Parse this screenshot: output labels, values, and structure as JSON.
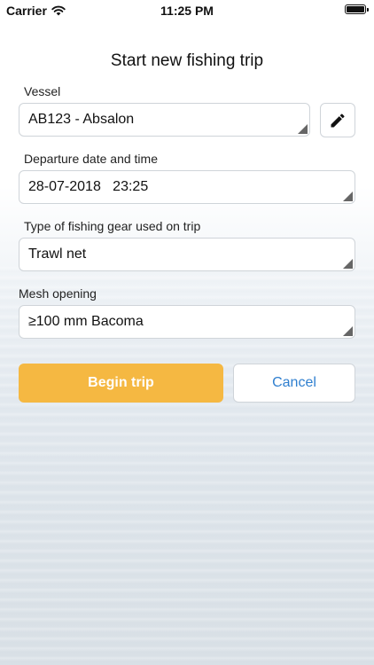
{
  "status_bar": {
    "carrier": "Carrier",
    "time": "11:25 PM"
  },
  "screen": {
    "title": "Start new fishing trip"
  },
  "form": {
    "vessel": {
      "label": "Vessel",
      "value": "AB123 - Absalon"
    },
    "departure": {
      "label": "Departure date and time",
      "value": "28-07-2018   23:25"
    },
    "gear": {
      "label": "Type of fishing gear used on trip",
      "value": "Trawl net"
    },
    "mesh": {
      "label": "Mesh opening",
      "value": "≥100 mm Bacoma"
    }
  },
  "actions": {
    "begin_label": "Begin trip",
    "cancel_label": "Cancel"
  },
  "icons": {
    "edit": "pencil-icon",
    "wifi": "wifi-icon",
    "battery": "battery-icon"
  },
  "colors": {
    "primary": "#f5b842",
    "link": "#2f7fcf"
  }
}
